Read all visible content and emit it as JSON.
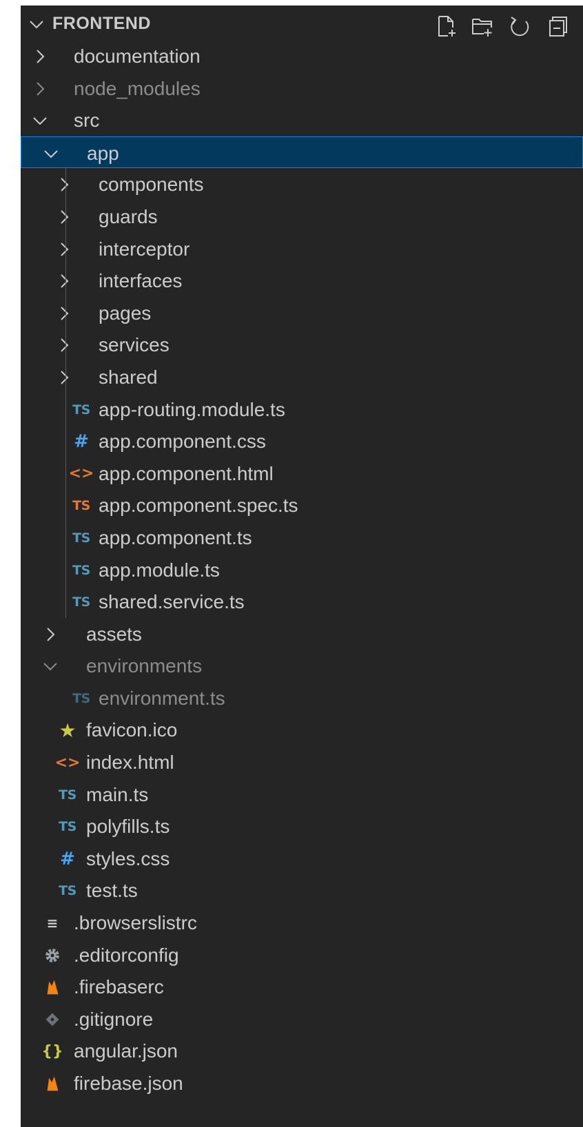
{
  "explorer": {
    "title": "FRONTEND",
    "actions": [
      {
        "name": "new-file-icon"
      },
      {
        "name": "new-folder-icon"
      },
      {
        "name": "refresh-icon"
      },
      {
        "name": "collapse-all-icon"
      }
    ],
    "items": [
      {
        "label": "documentation",
        "depth": 0,
        "kind": "folder",
        "expanded": false
      },
      {
        "label": "node_modules",
        "depth": 0,
        "kind": "folder",
        "expanded": false,
        "dim": true
      },
      {
        "label": "src",
        "depth": 0,
        "kind": "folder",
        "expanded": true
      },
      {
        "label": "app",
        "depth": 1,
        "kind": "folder",
        "expanded": true,
        "selected": true
      },
      {
        "label": "components",
        "depth": 2,
        "kind": "folder",
        "expanded": false
      },
      {
        "label": "guards",
        "depth": 2,
        "kind": "folder",
        "expanded": false
      },
      {
        "label": "interceptor",
        "depth": 2,
        "kind": "folder",
        "expanded": false
      },
      {
        "label": "interfaces",
        "depth": 2,
        "kind": "folder",
        "expanded": false
      },
      {
        "label": "pages",
        "depth": 2,
        "kind": "folder",
        "expanded": false
      },
      {
        "label": "services",
        "depth": 2,
        "kind": "folder",
        "expanded": false
      },
      {
        "label": "shared",
        "depth": 2,
        "kind": "folder",
        "expanded": false
      },
      {
        "label": "app-routing.module.ts",
        "depth": 2,
        "kind": "file",
        "icon": "ts-blue",
        "glyph": "TS"
      },
      {
        "label": "app.component.css",
        "depth": 2,
        "kind": "file",
        "icon": "css-blue",
        "glyph": "#"
      },
      {
        "label": "app.component.html",
        "depth": 2,
        "kind": "file",
        "icon": "html-orange",
        "glyph": "<>"
      },
      {
        "label": "app.component.spec.ts",
        "depth": 2,
        "kind": "file",
        "icon": "ts-orange",
        "glyph": "TS"
      },
      {
        "label": "app.component.ts",
        "depth": 2,
        "kind": "file",
        "icon": "ts-blue",
        "glyph": "TS"
      },
      {
        "label": "app.module.ts",
        "depth": 2,
        "kind": "file",
        "icon": "ts-blue",
        "glyph": "TS"
      },
      {
        "label": "shared.service.ts",
        "depth": 2,
        "kind": "file",
        "icon": "ts-blue",
        "glyph": "TS"
      },
      {
        "label": "assets",
        "depth": 1,
        "kind": "folder",
        "expanded": false
      },
      {
        "label": "environments",
        "depth": 1,
        "kind": "folder",
        "expanded": true,
        "dim": true
      },
      {
        "label": "environment.ts",
        "depth": 2,
        "kind": "file",
        "icon": "ts-blue",
        "glyph": "TS",
        "dim": true
      },
      {
        "label": "favicon.ico",
        "depth": 1,
        "kind": "file",
        "icon": "star-yellow",
        "glyph": "★"
      },
      {
        "label": "index.html",
        "depth": 1,
        "kind": "file",
        "icon": "html-orange",
        "glyph": "<>"
      },
      {
        "label": "main.ts",
        "depth": 1,
        "kind": "file",
        "icon": "ts-blue",
        "glyph": "TS"
      },
      {
        "label": "polyfills.ts",
        "depth": 1,
        "kind": "file",
        "icon": "ts-blue",
        "glyph": "TS"
      },
      {
        "label": "styles.css",
        "depth": 1,
        "kind": "file",
        "icon": "css-blue",
        "glyph": "#"
      },
      {
        "label": "test.ts",
        "depth": 1,
        "kind": "file",
        "icon": "ts-blue",
        "glyph": "TS"
      },
      {
        "label": ".browserslistrc",
        "depth": 0,
        "kind": "file",
        "icon": "lines-grey",
        "glyph": "≡"
      },
      {
        "label": ".editorconfig",
        "depth": 0,
        "kind": "file",
        "icon": "gear-grey",
        "glyph": ""
      },
      {
        "label": ".firebaserc",
        "depth": 0,
        "kind": "file",
        "icon": "firebase-orange",
        "glyph": ""
      },
      {
        "label": ".gitignore",
        "depth": 0,
        "kind": "file",
        "icon": "git-grey",
        "glyph": ""
      },
      {
        "label": "angular.json",
        "depth": 0,
        "kind": "file",
        "icon": "json-yellow",
        "glyph": "{}"
      },
      {
        "label": "firebase.json",
        "depth": 0,
        "kind": "file",
        "icon": "firebase-orange",
        "glyph": ""
      }
    ]
  },
  "colors": {
    "background": "#252526",
    "text": "#cccccc",
    "dim_text": "#8c8c8c",
    "selected_bg": "#04395e",
    "selected_border": "#1c7dd6",
    "ts_blue": "#519aba",
    "ts_orange": "#e37933",
    "css_blue": "#42a5f5",
    "html_orange": "#e37933",
    "json_yellow": "#cbcb41",
    "firebase_orange": "#f4840b"
  }
}
